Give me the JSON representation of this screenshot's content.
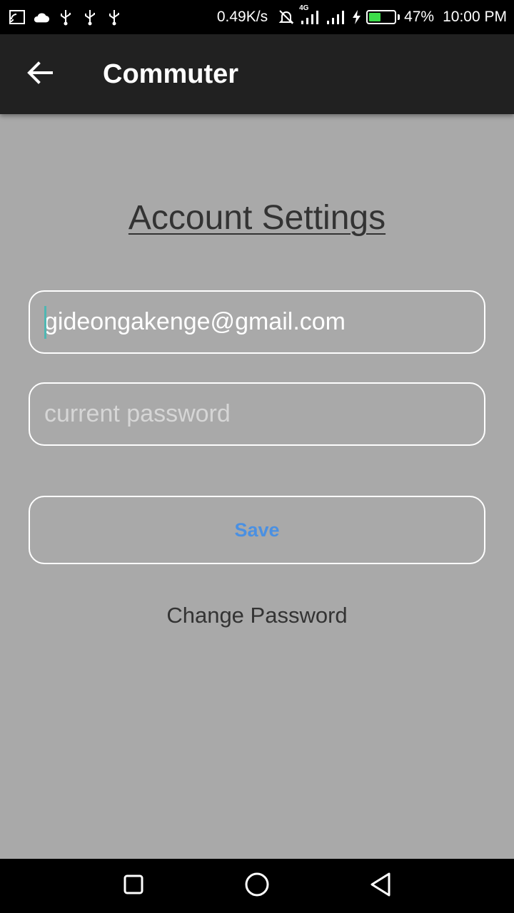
{
  "status_bar": {
    "net_speed": "0.49K/s",
    "network_type": "4G",
    "battery_percent": "47%",
    "battery_level": 0.47,
    "time": "10:00 PM",
    "left_icons": [
      "cast-icon",
      "cloud-icon",
      "usb-icon",
      "usb-icon",
      "usb-icon"
    ],
    "right_icons": [
      "mute-bell-icon",
      "signal-icon",
      "signal-icon",
      "charging-icon",
      "battery-icon"
    ]
  },
  "app_bar": {
    "title": "Commuter",
    "back_icon": "arrow-left-icon"
  },
  "main": {
    "page_title": "Account Settings",
    "email_value": "gideongakenge@gmail.com",
    "password_placeholder": "current password",
    "save_label": "Save",
    "change_password_label": "Change Password"
  },
  "nav_bar": {
    "icons": [
      "recent-apps-icon",
      "home-icon",
      "back-icon"
    ]
  },
  "colors": {
    "background": "#a9a9a9",
    "app_bar": "#212121",
    "accent_button_text": "#4a90e2",
    "battery_fill": "#3ddc4a"
  }
}
